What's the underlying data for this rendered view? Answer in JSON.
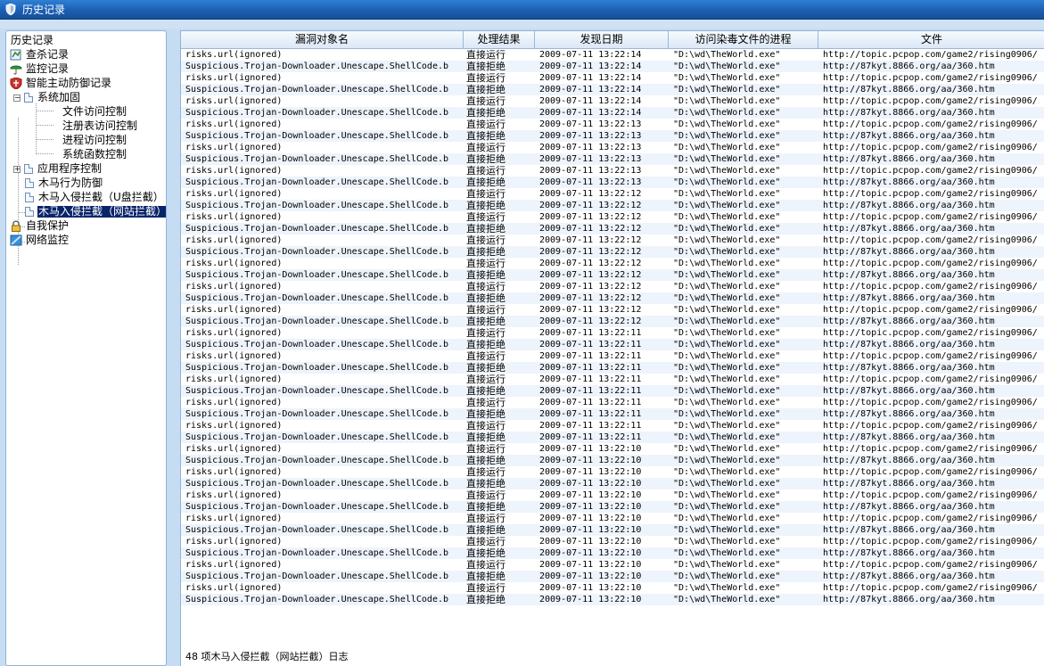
{
  "window": {
    "title": "历史记录"
  },
  "tree": {
    "root_label": "历史记录",
    "items": {
      "scan_log": "查杀记录",
      "monitor_log": "监控记录",
      "smart_defense_log": "智能主动防御记录",
      "system_hardening": "系统加固",
      "file_access": "文件访问控制",
      "registry_access": "注册表访问控制",
      "process_access": "进程访问控制",
      "system_function": "系统函数控制",
      "app_control": "应用程序控制",
      "trojan_behavior": "木马行为防御",
      "trojan_usb": "木马入侵拦截（U盘拦截）",
      "trojan_web": "木马入侵拦截（网站拦截）",
      "self_protect": "自我保护",
      "net_monitor": "网络监控"
    }
  },
  "table": {
    "columns": [
      "漏洞对象名",
      "处理结果",
      "发现日期",
      "访问染毒文件的进程",
      "文件"
    ],
    "rows": [
      [
        "risks.url(ignored)",
        "直接运行",
        "2009-07-11 13:22:14",
        "\"D:\\wd\\TheWorld.exe\"",
        "http://topic.pcpop.com/game2/rising0906/"
      ],
      [
        "Suspicious.Trojan-Downloader.Unescape.ShellCode.b",
        "直接拒绝",
        "2009-07-11 13:22:14",
        "\"D:\\wd\\TheWorld.exe\"",
        "http://87kyt.8866.org/aa/360.htm"
      ],
      [
        "risks.url(ignored)",
        "直接运行",
        "2009-07-11 13:22:14",
        "\"D:\\wd\\TheWorld.exe\"",
        "http://topic.pcpop.com/game2/rising0906/"
      ],
      [
        "Suspicious.Trojan-Downloader.Unescape.ShellCode.b",
        "直接拒绝",
        "2009-07-11 13:22:14",
        "\"D:\\wd\\TheWorld.exe\"",
        "http://87kyt.8866.org/aa/360.htm"
      ],
      [
        "risks.url(ignored)",
        "直接运行",
        "2009-07-11 13:22:14",
        "\"D:\\wd\\TheWorld.exe\"",
        "http://topic.pcpop.com/game2/rising0906/"
      ],
      [
        "Suspicious.Trojan-Downloader.Unescape.ShellCode.b",
        "直接拒绝",
        "2009-07-11 13:22:14",
        "\"D:\\wd\\TheWorld.exe\"",
        "http://87kyt.8866.org/aa/360.htm"
      ],
      [
        "risks.url(ignored)",
        "直接运行",
        "2009-07-11 13:22:13",
        "\"D:\\wd\\TheWorld.exe\"",
        "http://topic.pcpop.com/game2/rising0906/"
      ],
      [
        "Suspicious.Trojan-Downloader.Unescape.ShellCode.b",
        "直接拒绝",
        "2009-07-11 13:22:13",
        "\"D:\\wd\\TheWorld.exe\"",
        "http://87kyt.8866.org/aa/360.htm"
      ],
      [
        "risks.url(ignored)",
        "直接运行",
        "2009-07-11 13:22:13",
        "\"D:\\wd\\TheWorld.exe\"",
        "http://topic.pcpop.com/game2/rising0906/"
      ],
      [
        "Suspicious.Trojan-Downloader.Unescape.ShellCode.b",
        "直接拒绝",
        "2009-07-11 13:22:13",
        "\"D:\\wd\\TheWorld.exe\"",
        "http://87kyt.8866.org/aa/360.htm"
      ],
      [
        "risks.url(ignored)",
        "直接运行",
        "2009-07-11 13:22:13",
        "\"D:\\wd\\TheWorld.exe\"",
        "http://topic.pcpop.com/game2/rising0906/"
      ],
      [
        "Suspicious.Trojan-Downloader.Unescape.ShellCode.b",
        "直接拒绝",
        "2009-07-11 13:22:13",
        "\"D:\\wd\\TheWorld.exe\"",
        "http://87kyt.8866.org/aa/360.htm"
      ],
      [
        "risks.url(ignored)",
        "直接运行",
        "2009-07-11 13:22:12",
        "\"D:\\wd\\TheWorld.exe\"",
        "http://topic.pcpop.com/game2/rising0906/"
      ],
      [
        "Suspicious.Trojan-Downloader.Unescape.ShellCode.b",
        "直接拒绝",
        "2009-07-11 13:22:12",
        "\"D:\\wd\\TheWorld.exe\"",
        "http://87kyt.8866.org/aa/360.htm"
      ],
      [
        "risks.url(ignored)",
        "直接运行",
        "2009-07-11 13:22:12",
        "\"D:\\wd\\TheWorld.exe\"",
        "http://topic.pcpop.com/game2/rising0906/"
      ],
      [
        "Suspicious.Trojan-Downloader.Unescape.ShellCode.b",
        "直接拒绝",
        "2009-07-11 13:22:12",
        "\"D:\\wd\\TheWorld.exe\"",
        "http://87kyt.8866.org/aa/360.htm"
      ],
      [
        "risks.url(ignored)",
        "直接运行",
        "2009-07-11 13:22:12",
        "\"D:\\wd\\TheWorld.exe\"",
        "http://topic.pcpop.com/game2/rising0906/"
      ],
      [
        "Suspicious.Trojan-Downloader.Unescape.ShellCode.b",
        "直接拒绝",
        "2009-07-11 13:22:12",
        "\"D:\\wd\\TheWorld.exe\"",
        "http://87kyt.8866.org/aa/360.htm"
      ],
      [
        "risks.url(ignored)",
        "直接运行",
        "2009-07-11 13:22:12",
        "\"D:\\wd\\TheWorld.exe\"",
        "http://topic.pcpop.com/game2/rising0906/"
      ],
      [
        "Suspicious.Trojan-Downloader.Unescape.ShellCode.b",
        "直接拒绝",
        "2009-07-11 13:22:12",
        "\"D:\\wd\\TheWorld.exe\"",
        "http://87kyt.8866.org/aa/360.htm"
      ],
      [
        "risks.url(ignored)",
        "直接运行",
        "2009-07-11 13:22:12",
        "\"D:\\wd\\TheWorld.exe\"",
        "http://topic.pcpop.com/game2/rising0906/"
      ],
      [
        "Suspicious.Trojan-Downloader.Unescape.ShellCode.b",
        "直接拒绝",
        "2009-07-11 13:22:12",
        "\"D:\\wd\\TheWorld.exe\"",
        "http://87kyt.8866.org/aa/360.htm"
      ],
      [
        "risks.url(ignored)",
        "直接运行",
        "2009-07-11 13:22:12",
        "\"D:\\wd\\TheWorld.exe\"",
        "http://topic.pcpop.com/game2/rising0906/"
      ],
      [
        "Suspicious.Trojan-Downloader.Unescape.ShellCode.b",
        "直接拒绝",
        "2009-07-11 13:22:12",
        "\"D:\\wd\\TheWorld.exe\"",
        "http://87kyt.8866.org/aa/360.htm"
      ],
      [
        "risks.url(ignored)",
        "直接运行",
        "2009-07-11 13:22:11",
        "\"D:\\wd\\TheWorld.exe\"",
        "http://topic.pcpop.com/game2/rising0906/"
      ],
      [
        "Suspicious.Trojan-Downloader.Unescape.ShellCode.b",
        "直接拒绝",
        "2009-07-11 13:22:11",
        "\"D:\\wd\\TheWorld.exe\"",
        "http://87kyt.8866.org/aa/360.htm"
      ],
      [
        "risks.url(ignored)",
        "直接运行",
        "2009-07-11 13:22:11",
        "\"D:\\wd\\TheWorld.exe\"",
        "http://topic.pcpop.com/game2/rising0906/"
      ],
      [
        "Suspicious.Trojan-Downloader.Unescape.ShellCode.b",
        "直接拒绝",
        "2009-07-11 13:22:11",
        "\"D:\\wd\\TheWorld.exe\"",
        "http://87kyt.8866.org/aa/360.htm"
      ],
      [
        "risks.url(ignored)",
        "直接运行",
        "2009-07-11 13:22:11",
        "\"D:\\wd\\TheWorld.exe\"",
        "http://topic.pcpop.com/game2/rising0906/"
      ],
      [
        "Suspicious.Trojan-Downloader.Unescape.ShellCode.b",
        "直接拒绝",
        "2009-07-11 13:22:11",
        "\"D:\\wd\\TheWorld.exe\"",
        "http://87kyt.8866.org/aa/360.htm"
      ],
      [
        "risks.url(ignored)",
        "直接运行",
        "2009-07-11 13:22:11",
        "\"D:\\wd\\TheWorld.exe\"",
        "http://topic.pcpop.com/game2/rising0906/"
      ],
      [
        "Suspicious.Trojan-Downloader.Unescape.ShellCode.b",
        "直接拒绝",
        "2009-07-11 13:22:11",
        "\"D:\\wd\\TheWorld.exe\"",
        "http://87kyt.8866.org/aa/360.htm"
      ],
      [
        "risks.url(ignored)",
        "直接运行",
        "2009-07-11 13:22:11",
        "\"D:\\wd\\TheWorld.exe\"",
        "http://topic.pcpop.com/game2/rising0906/"
      ],
      [
        "Suspicious.Trojan-Downloader.Unescape.ShellCode.b",
        "直接拒绝",
        "2009-07-11 13:22:11",
        "\"D:\\wd\\TheWorld.exe\"",
        "http://87kyt.8866.org/aa/360.htm"
      ],
      [
        "risks.url(ignored)",
        "直接运行",
        "2009-07-11 13:22:10",
        "\"D:\\wd\\TheWorld.exe\"",
        "http://topic.pcpop.com/game2/rising0906/"
      ],
      [
        "Suspicious.Trojan-Downloader.Unescape.ShellCode.b",
        "直接拒绝",
        "2009-07-11 13:22:10",
        "\"D:\\wd\\TheWorld.exe\"",
        "http://87kyt.8866.org/aa/360.htm"
      ],
      [
        "risks.url(ignored)",
        "直接运行",
        "2009-07-11 13:22:10",
        "\"D:\\wd\\TheWorld.exe\"",
        "http://topic.pcpop.com/game2/rising0906/"
      ],
      [
        "Suspicious.Trojan-Downloader.Unescape.ShellCode.b",
        "直接拒绝",
        "2009-07-11 13:22:10",
        "\"D:\\wd\\TheWorld.exe\"",
        "http://87kyt.8866.org/aa/360.htm"
      ],
      [
        "risks.url(ignored)",
        "直接运行",
        "2009-07-11 13:22:10",
        "\"D:\\wd\\TheWorld.exe\"",
        "http://topic.pcpop.com/game2/rising0906/"
      ],
      [
        "Suspicious.Trojan-Downloader.Unescape.ShellCode.b",
        "直接拒绝",
        "2009-07-11 13:22:10",
        "\"D:\\wd\\TheWorld.exe\"",
        "http://87kyt.8866.org/aa/360.htm"
      ],
      [
        "risks.url(ignored)",
        "直接运行",
        "2009-07-11 13:22:10",
        "\"D:\\wd\\TheWorld.exe\"",
        "http://topic.pcpop.com/game2/rising0906/"
      ],
      [
        "Suspicious.Trojan-Downloader.Unescape.ShellCode.b",
        "直接拒绝",
        "2009-07-11 13:22:10",
        "\"D:\\wd\\TheWorld.exe\"",
        "http://87kyt.8866.org/aa/360.htm"
      ],
      [
        "risks.url(ignored)",
        "直接运行",
        "2009-07-11 13:22:10",
        "\"D:\\wd\\TheWorld.exe\"",
        "http://topic.pcpop.com/game2/rising0906/"
      ],
      [
        "Suspicious.Trojan-Downloader.Unescape.ShellCode.b",
        "直接拒绝",
        "2009-07-11 13:22:10",
        "\"D:\\wd\\TheWorld.exe\"",
        "http://87kyt.8866.org/aa/360.htm"
      ],
      [
        "risks.url(ignored)",
        "直接运行",
        "2009-07-11 13:22:10",
        "\"D:\\wd\\TheWorld.exe\"",
        "http://topic.pcpop.com/game2/rising0906/"
      ],
      [
        "Suspicious.Trojan-Downloader.Unescape.ShellCode.b",
        "直接拒绝",
        "2009-07-11 13:22:10",
        "\"D:\\wd\\TheWorld.exe\"",
        "http://87kyt.8866.org/aa/360.htm"
      ],
      [
        "risks.url(ignored)",
        "直接运行",
        "2009-07-11 13:22:10",
        "\"D:\\wd\\TheWorld.exe\"",
        "http://topic.pcpop.com/game2/rising0906/"
      ],
      [
        "Suspicious.Trojan-Downloader.Unescape.ShellCode.b",
        "直接拒绝",
        "2009-07-11 13:22:10",
        "\"D:\\wd\\TheWorld.exe\"",
        "http://87kyt.8866.org/aa/360.htm"
      ]
    ]
  },
  "status": {
    "text": "48 项木马入侵拦截（网站拦截）日志"
  },
  "colors": {
    "title_bar": "#1b5fb3",
    "selection": "#0a246a",
    "panel_border": "#8fb3d9",
    "background": "#c6dcf2"
  }
}
